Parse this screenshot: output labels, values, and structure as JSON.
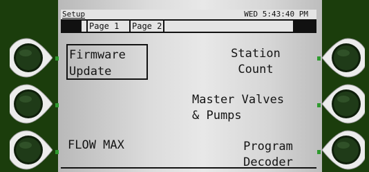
{
  "status_bar": {
    "title": "Setup",
    "datetime": "WED 5:43:40 PM"
  },
  "tabs": [
    {
      "label": "Page 1",
      "active": true
    },
    {
      "label": "Page 2",
      "active": false
    }
  ],
  "softkeys": {
    "left": [
      {
        "label": "Firmware\nUpdate",
        "selected": true
      },
      {
        "label": "",
        "selected": false
      },
      {
        "label": "FLOW MAX",
        "selected": false
      }
    ],
    "right": [
      {
        "label": "Station\nCount",
        "selected": false
      },
      {
        "label": "Master Valves\n& Pumps",
        "selected": false
      },
      {
        "label": "Program\nDecoder",
        "selected": false
      }
    ]
  },
  "colors": {
    "bezel": "#1b3d0c",
    "button_face": "#1f3b18",
    "button_rim": "#e8e8e8",
    "led": "#2f9a2f"
  }
}
